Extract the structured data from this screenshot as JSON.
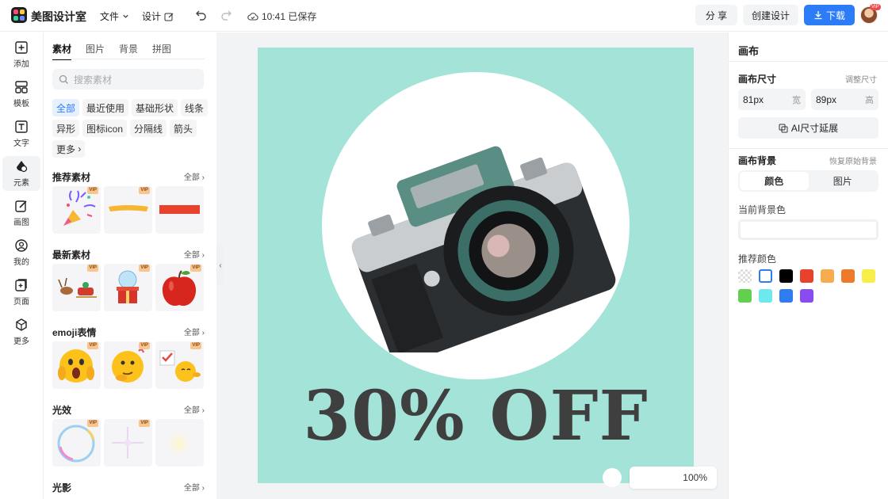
{
  "app": {
    "name": "美图设计室"
  },
  "topbar": {
    "file_menu": "文件",
    "design_menu": "设计",
    "save_status": "10:41 已保存",
    "share": "分 享",
    "create": "创建设计",
    "download": "下载",
    "avatar_badge": "VIP"
  },
  "leftnav": [
    {
      "label": "添加",
      "icon": "plus-square-icon"
    },
    {
      "label": "模板",
      "icon": "template-icon"
    },
    {
      "label": "文字",
      "icon": "text-icon"
    },
    {
      "label": "元素",
      "icon": "element-icon"
    },
    {
      "label": "画图",
      "icon": "draw-icon"
    },
    {
      "label": "我的",
      "icon": "user-icon"
    },
    {
      "label": "页面",
      "icon": "page-icon"
    },
    {
      "label": "更多",
      "icon": "cube-icon"
    }
  ],
  "panel": {
    "tabs": [
      "素材",
      "图片",
      "背景",
      "拼图"
    ],
    "search_placeholder": "搜索素材",
    "chips": [
      "全部",
      "最近使用",
      "基础形状",
      "线条",
      "异形",
      "图标icon",
      "分隔线",
      "箭头",
      "更多"
    ],
    "vip": "VIP",
    "sections": [
      {
        "title": "推荐素材",
        "all": "全部"
      },
      {
        "title": "最新素材",
        "all": "全部"
      },
      {
        "title": "emoji表情",
        "all": "全部"
      },
      {
        "title": "光效",
        "all": "全部"
      },
      {
        "title": "光影",
        "all": "全部"
      }
    ]
  },
  "canvas": {
    "background": "#a4e3d7",
    "offer_text": "30% OFF",
    "zoom": "100%"
  },
  "right": {
    "title": "画布",
    "size_label": "画布尺寸",
    "resize_link": "调整尺寸",
    "width_value": "81px",
    "width_unit": "宽",
    "height_value": "89px",
    "height_unit": "高",
    "ai_extend": "AI尺寸延展",
    "bg_label": "画布背景",
    "restore_link": "恢复原始背景",
    "seg_color": "颜色",
    "seg_image": "图片",
    "current_bg": "当前背景色",
    "recommended": "推荐颜色",
    "colors": [
      "transparent",
      "#ffffff",
      "#000000",
      "#e8412c",
      "#f5ad4f",
      "#ee7a2c",
      "#f7ee4a",
      "#62cf4d",
      "#6ee8ef",
      "#2f7cf0",
      "#8a4cf0"
    ]
  }
}
